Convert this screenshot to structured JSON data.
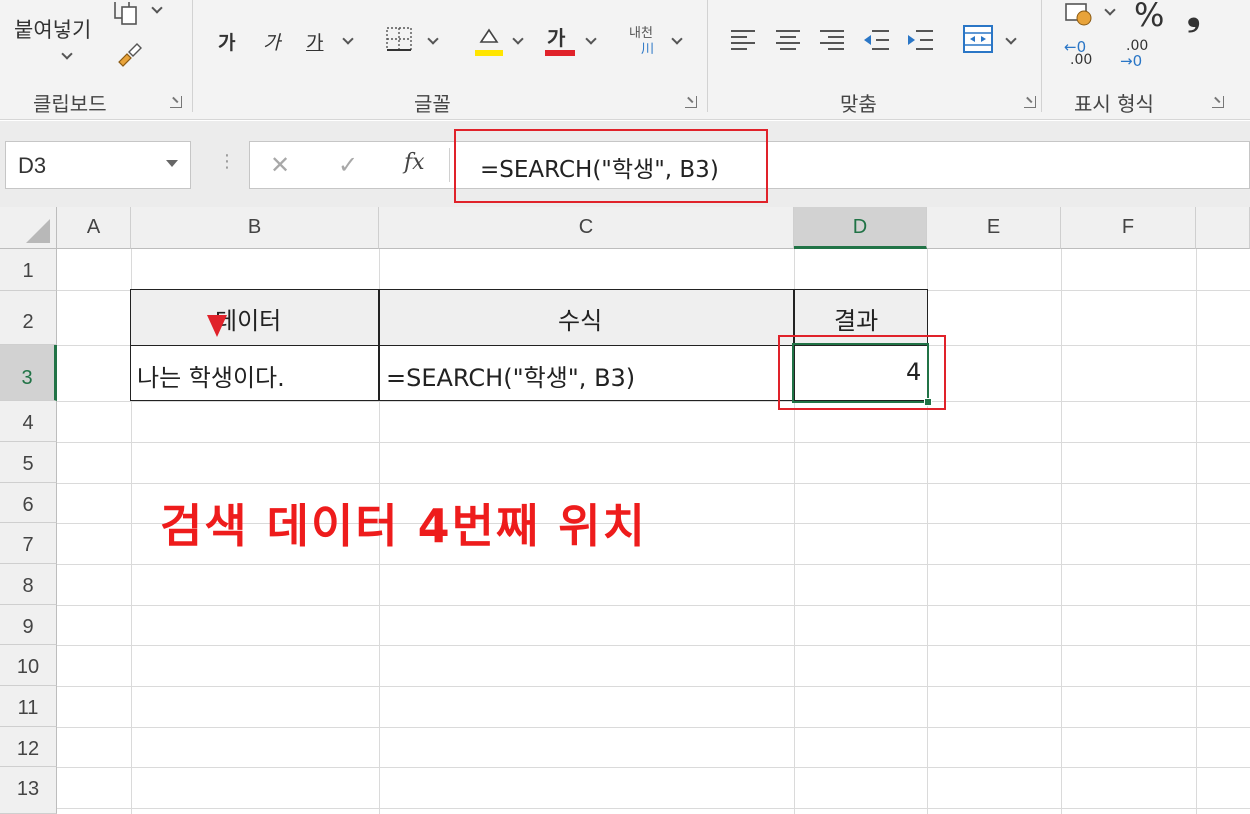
{
  "ribbon": {
    "clipboard": {
      "paste_label": "붙여넣기",
      "group_label": "클립보드"
    },
    "font": {
      "group_label": "글꼴",
      "grow_label": "가",
      "shrink_label": "가",
      "style_label": "가",
      "font_color_label": "가",
      "wrap_label_top": "내천",
      "wrap_label_bottom": "川"
    },
    "alignment": {
      "group_label": "맞춤"
    },
    "number": {
      "group_label": "표시 형식",
      "percent_label": "%",
      "comma_label": "❟",
      "increase_dec_label": ".00",
      "decrease_dec_label": ".00"
    }
  },
  "formula_bar": {
    "name_box": "D3",
    "cancel_label": "✕",
    "enter_label": "✓",
    "fx_label": "fx",
    "formula": "=SEARCH(\"학생\", B3)"
  },
  "columns": [
    "A",
    "B",
    "C",
    "D",
    "E",
    "F"
  ],
  "rows": [
    "1",
    "2",
    "3",
    "4",
    "5",
    "6",
    "7",
    "8",
    "9",
    "10",
    "11",
    "12",
    "13"
  ],
  "table": {
    "header_data": "데이터",
    "header_formula": "수식",
    "header_result": "결과",
    "b3": "나는 학생이다.",
    "c3": "=SEARCH(\"학생\", B3)",
    "d3": "4"
  },
  "annotation": {
    "text": "검색 데이터 4번째 위치",
    "color": "#ee1c1c"
  },
  "colors": {
    "accent_green": "#217346",
    "highlight_red": "#e0222a"
  }
}
